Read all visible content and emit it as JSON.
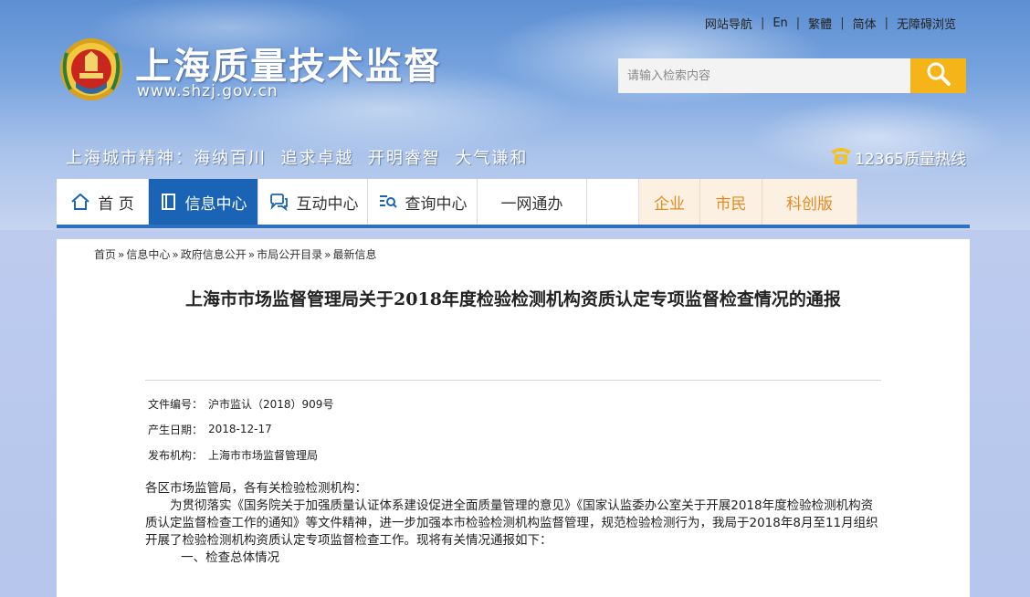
{
  "header": {
    "top_links": [
      "网站导航",
      "En",
      "繁體",
      "简体",
      "无障碍浏览"
    ],
    "site_title": "上海质量技术监督",
    "site_url": "www.shzj.gov.cn",
    "search_placeholder": "请输入检索内容",
    "spirit_slogan": "上海城市精神：海纳百川  追求卓越  开明睿智  大气谦和",
    "hotline": "12365质量热线"
  },
  "nav": {
    "items": [
      {
        "label": "首 页",
        "icon": "home-icon"
      },
      {
        "label": "信息中心",
        "icon": "book-icon"
      },
      {
        "label": "互动中心",
        "icon": "chat-icon"
      },
      {
        "label": "查询中心",
        "icon": "search-list-icon"
      },
      {
        "label": "一网通办",
        "icon": ""
      }
    ],
    "audience": [
      "企业",
      "市民",
      "科创版"
    ],
    "active_color": "#1a63b5",
    "accent_color": "#e58a1f"
  },
  "breadcrumb": [
    "首页",
    "信息中心",
    "政府信息公开",
    "市局公开目录",
    "最新信息"
  ],
  "article": {
    "title": "上海市市场监督管理局关于2018年度检验检测机构资质认定专项监督检查情况的通报",
    "meta": [
      {
        "label": "文件编号：",
        "value": "沪市监认（2018）909号"
      },
      {
        "label": "产生日期：",
        "value": "2018-12-17"
      },
      {
        "label": "发布机构：",
        "value": "上海市市场监督管理局"
      }
    ],
    "greeting": "各区市场监管局，各有关检验检测机构：",
    "paragraph1": "为贯彻落实《国务院关于加强质量认证体系建设促进全面质量管理的意见》《国家认监委办公室关于开展2018年度检验检测机构资质认定监督检查工作的通知》等文件精神，进一步加强本市检验检测机构监督管理，规范检验检测行为，我局于2018年8月至11月组织开展了检验检测机构资质认定专项监督检查工作。现将有关情况通报如下：",
    "section1": "一、检查总体情况"
  }
}
